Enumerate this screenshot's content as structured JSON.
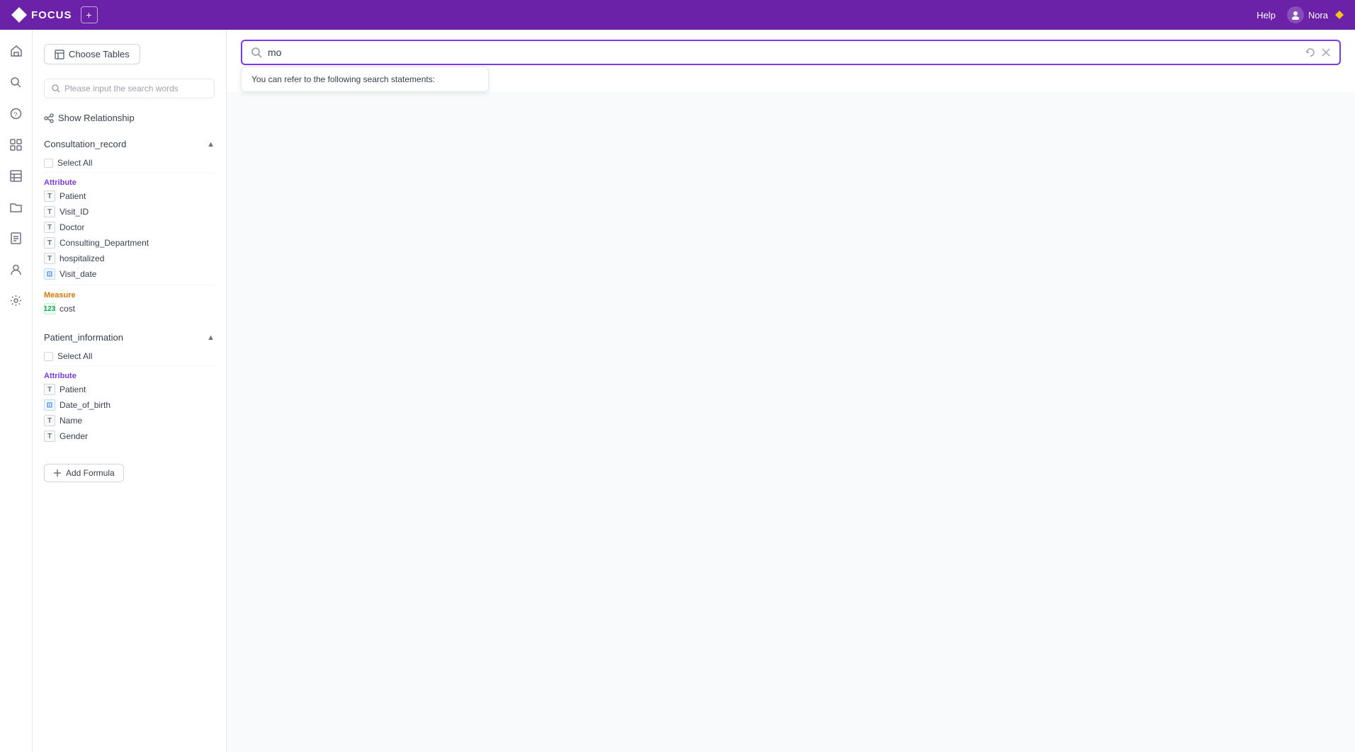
{
  "app": {
    "name": "FOCUS",
    "help_label": "Help",
    "user_name": "Nora"
  },
  "topbar": {
    "add_tab_label": "+"
  },
  "iconbar": {
    "icons": [
      {
        "name": "home-icon",
        "symbol": "⌂"
      },
      {
        "name": "search-icon",
        "symbol": "⌕"
      },
      {
        "name": "question-icon",
        "symbol": "?"
      },
      {
        "name": "grid-icon",
        "symbol": "⊞"
      },
      {
        "name": "table-icon",
        "symbol": "▦"
      },
      {
        "name": "folder-icon",
        "symbol": "⊟"
      },
      {
        "name": "report-icon",
        "symbol": "⊡"
      },
      {
        "name": "user-icon",
        "symbol": "⊙"
      },
      {
        "name": "settings-icon",
        "symbol": "⚙"
      }
    ]
  },
  "sidebar": {
    "choose_tables_label": "Choose Tables",
    "search_placeholder": "Please input the search words",
    "show_relationship_label": "Show Relationship",
    "tables": [
      {
        "name": "Consultation_record",
        "select_all_label": "Select All",
        "attribute_label": "Attribute",
        "attributes": [
          {
            "field": "Patient",
            "type": "T"
          },
          {
            "field": "Visit_ID",
            "type": "T"
          },
          {
            "field": "Doctor",
            "type": "T"
          },
          {
            "field": "Consulting_Department",
            "type": "T"
          },
          {
            "field": "hospitalized",
            "type": "T"
          },
          {
            "field": "Visit_date",
            "type": "D"
          }
        ],
        "measure_label": "Measure",
        "measures": [
          {
            "field": "cost",
            "type": "N"
          }
        ]
      },
      {
        "name": "Patient_information",
        "select_all_label": "Select All",
        "attribute_label": "Attribute",
        "attributes": [
          {
            "field": "Patient",
            "type": "T"
          },
          {
            "field": "Date_of_birth",
            "type": "D"
          },
          {
            "field": "Name",
            "type": "T"
          },
          {
            "field": "Gender",
            "type": "T"
          }
        ],
        "measure_label": null,
        "measures": []
      }
    ],
    "add_formula_label": "Add Formula"
  },
  "search": {
    "current_value": "mo",
    "cursor_visible": true,
    "suggestion_text": "You can refer to the following search statements:"
  }
}
